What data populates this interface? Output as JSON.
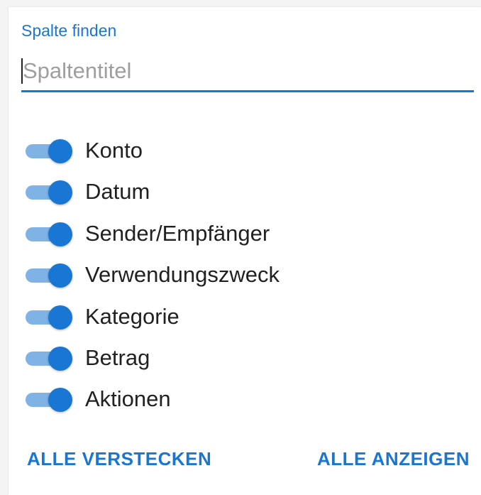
{
  "search": {
    "label": "Spalte finden",
    "placeholder": "Spaltentitel",
    "value": ""
  },
  "columns": [
    {
      "label": "Konto",
      "enabled": true
    },
    {
      "label": "Datum",
      "enabled": true
    },
    {
      "label": "Sender/Empfänger",
      "enabled": true
    },
    {
      "label": "Verwendungszweck",
      "enabled": true
    },
    {
      "label": "Kategorie",
      "enabled": true
    },
    {
      "label": "Betrag",
      "enabled": true
    },
    {
      "label": "Aktionen",
      "enabled": true
    }
  ],
  "actions": {
    "hide_all": "ALLE VERSTECKEN",
    "show_all": "ALLE ANZEIGEN"
  },
  "colors": {
    "accent": "#1976d2",
    "track": "#7fb3e6",
    "text": "#212121",
    "placeholder": "#9e9e9e"
  }
}
